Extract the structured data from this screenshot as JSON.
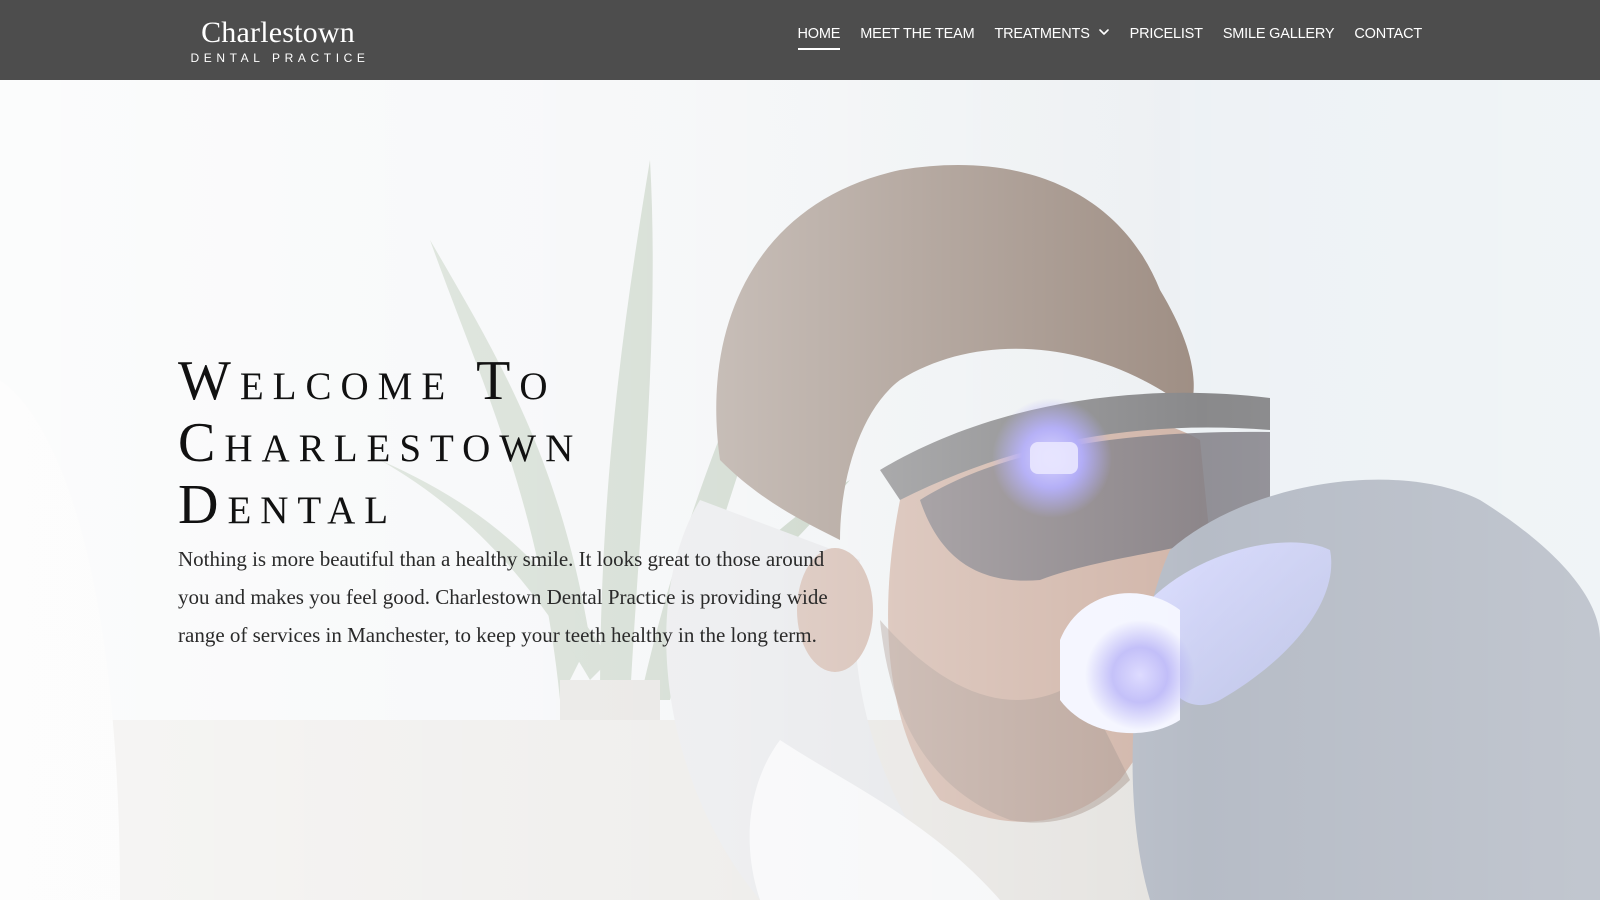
{
  "brand": {
    "name": "Charlestown",
    "subtitle": "DENTAL PRACTICE"
  },
  "nav": {
    "items": [
      {
        "label": "HOME",
        "active": true
      },
      {
        "label": "MEET THE TEAM",
        "active": false
      },
      {
        "label": "TREATMENTS",
        "active": false,
        "has_dropdown": true
      },
      {
        "label": "PRICELIST",
        "active": false
      },
      {
        "label": "SMILE GALLERY",
        "active": false
      },
      {
        "label": "CONTACT",
        "active": false
      }
    ]
  },
  "hero": {
    "title_lines": [
      "Welcome To",
      "Charlestown",
      "Dental"
    ],
    "body": "Nothing is more beautiful than a healthy smile. It looks great to those around you and makes you feel good. Charlestown Dental Practice is providing wide range of services in Manchester, to keep your teeth healthy in the long term."
  },
  "colors": {
    "header_bg": "#4d4d4d",
    "header_text": "#ffffff",
    "title_text": "#111111",
    "body_text": "#2a2a2a"
  },
  "icons": {
    "dropdown": "chevron-down-icon"
  }
}
